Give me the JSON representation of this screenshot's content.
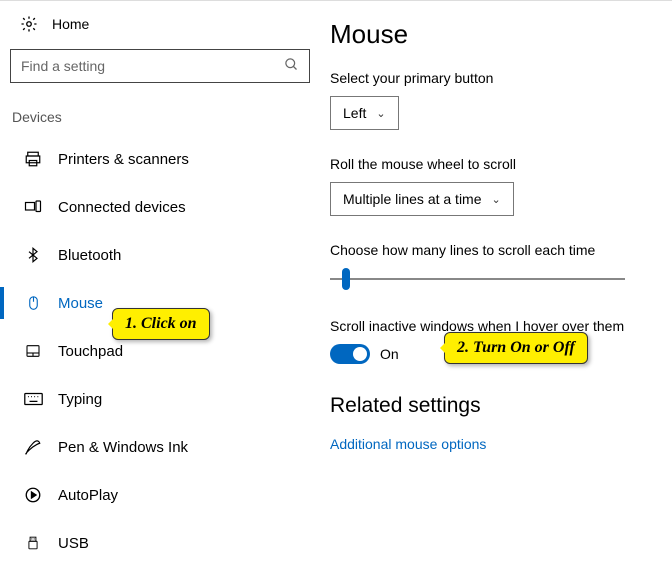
{
  "sidebar": {
    "home": "Home",
    "search_placeholder": "Find a setting",
    "category": "Devices",
    "items": [
      {
        "label": "Printers & scanners",
        "icon": "printer-icon"
      },
      {
        "label": "Connected devices",
        "icon": "connected-devices-icon"
      },
      {
        "label": "Bluetooth",
        "icon": "bluetooth-icon"
      },
      {
        "label": "Mouse",
        "icon": "mouse-icon",
        "selected": true
      },
      {
        "label": "Touchpad",
        "icon": "touchpad-icon"
      },
      {
        "label": "Typing",
        "icon": "keyboard-icon"
      },
      {
        "label": "Pen & Windows Ink",
        "icon": "pen-icon"
      },
      {
        "label": "AutoPlay",
        "icon": "autoplay-icon"
      },
      {
        "label": "USB",
        "icon": "usb-icon"
      }
    ]
  },
  "main": {
    "title": "Mouse",
    "primary_label": "Select your primary button",
    "primary_value": "Left",
    "wheel_label": "Roll the mouse wheel to scroll",
    "wheel_value": "Multiple lines at a time",
    "lines_label": "Choose how many lines to scroll each time",
    "slider_percent": 4,
    "inactive_label": "Scroll inactive windows when I hover over them",
    "toggle_state": "On",
    "related_heading": "Related settings",
    "related_link": "Additional mouse options"
  },
  "callouts": {
    "c1": "1. Click on",
    "c2": "2. Turn On or Off"
  }
}
